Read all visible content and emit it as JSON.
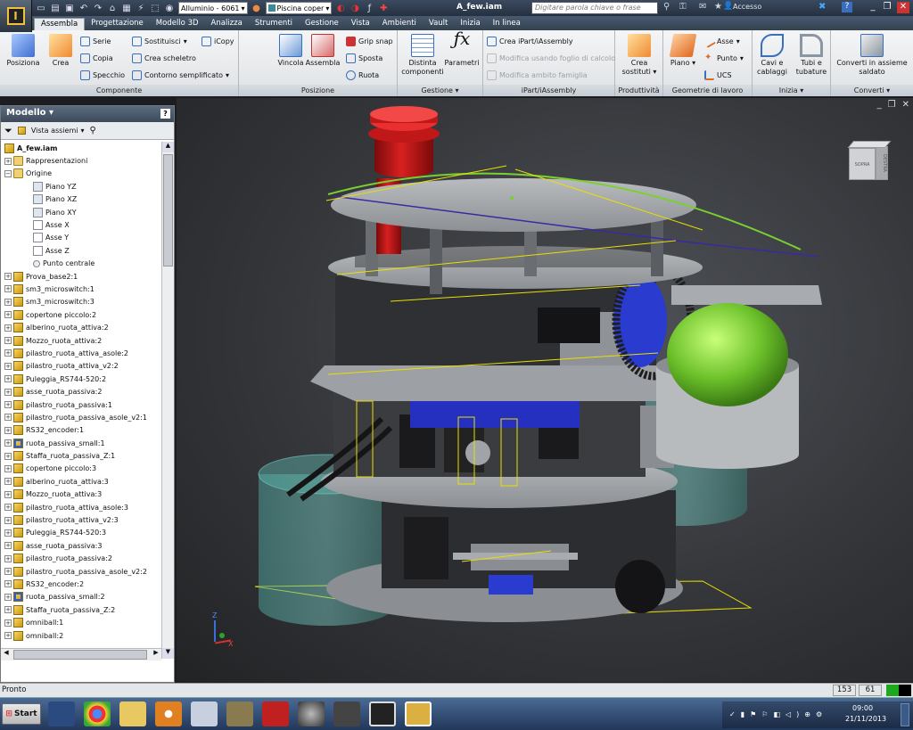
{
  "titlebar": {
    "app_badge": "PRO",
    "material": "Alluminio - 6061",
    "appearance": "Piscina coper",
    "doc_title": "A_few.iam",
    "search_placeholder": "Digitare parola chiave o frase",
    "login": "Accesso",
    "help": "?"
  },
  "tabs": [
    "Assembla",
    "Progettazione",
    "Modello 3D",
    "Analizza",
    "Strumenti",
    "Gestione",
    "Vista",
    "Ambienti",
    "Vault",
    "Inizia",
    "In linea"
  ],
  "ribbon": {
    "componente": {
      "label": "Componente",
      "posiziona": "Posiziona",
      "crea": "Crea",
      "serie": "Serie",
      "copia": "Copia",
      "specchio": "Specchio",
      "sostituisci": "Sostituisci",
      "crea_scheletro": "Crea scheletro",
      "contorno": "Contorno semplificato",
      "icopy": "iCopy"
    },
    "posizione": {
      "label": "Posizione",
      "vincola": "Vincola",
      "assembla": "Assembla",
      "grip_snap": "Grip snap",
      "sposta": "Sposta",
      "ruota": "Ruota"
    },
    "gestione": {
      "label": "Gestione",
      "distinta": "Distinta componenti",
      "parametri": "Parametri"
    },
    "ipart": {
      "label": "iPart/iAssembly",
      "crea": "Crea iPart/iAssembly",
      "modifica_foglio": "Modifica usando foglio di calcolo",
      "modifica_ambito": "Modifica ambito famiglia"
    },
    "produttivita": {
      "label": "Produttività",
      "crea_sostituti": "Crea sostituti"
    },
    "geometrie": {
      "label": "Geometrie di lavoro",
      "piano": "Piano",
      "asse": "Asse",
      "punto": "Punto",
      "ucs": "UCS"
    },
    "inizia": {
      "label": "Inizia",
      "cavi": "Cavi e cablaggi",
      "tubi": "Tubi e tubature"
    },
    "converti": {
      "label": "Converti",
      "converti_saldato": "Converti in assieme saldato"
    }
  },
  "browser": {
    "title": "Modello",
    "view_mode": "Vista assiemi",
    "root": "A_few.iam",
    "nodes": [
      {
        "label": "Rappresentazioni",
        "type": "folder",
        "level": 1,
        "exp": "+"
      },
      {
        "label": "Origine",
        "type": "folder",
        "level": 1,
        "exp": "−"
      },
      {
        "label": "Piano YZ",
        "type": "plane",
        "level": 2,
        "exp": ""
      },
      {
        "label": "Piano XZ",
        "type": "plane",
        "level": 2,
        "exp": ""
      },
      {
        "label": "Piano XY",
        "type": "plane",
        "level": 2,
        "exp": ""
      },
      {
        "label": "Asse X",
        "type": "axis",
        "level": 2,
        "exp": ""
      },
      {
        "label": "Asse Y",
        "type": "axis",
        "level": 2,
        "exp": ""
      },
      {
        "label": "Asse Z",
        "type": "axis",
        "level": 2,
        "exp": ""
      },
      {
        "label": "Punto centrale",
        "type": "pt",
        "level": 2,
        "exp": ""
      },
      {
        "label": "Prova_base2:1",
        "type": "part",
        "level": 1,
        "exp": "+"
      },
      {
        "label": "sm3_microswitch:1",
        "type": "part",
        "level": 1,
        "exp": "+"
      },
      {
        "label": "sm3_microswitch:3",
        "type": "part",
        "level": 1,
        "exp": "+"
      },
      {
        "label": "copertone piccolo:2",
        "type": "part",
        "level": 1,
        "exp": "+"
      },
      {
        "label": "alberino_ruota_attiva:2",
        "type": "part",
        "level": 1,
        "exp": "+"
      },
      {
        "label": "Mozzo_ruota_attiva:2",
        "type": "part",
        "level": 1,
        "exp": "+"
      },
      {
        "label": "pilastro_ruota_attiva_asole:2",
        "type": "part",
        "level": 1,
        "exp": "+"
      },
      {
        "label": "pilastro_ruota_attiva_v2:2",
        "type": "part",
        "level": 1,
        "exp": "+"
      },
      {
        "label": "Puleggia_RS744-520:2",
        "type": "part",
        "level": 1,
        "exp": "+"
      },
      {
        "label": "asse_ruota_passiva:2",
        "type": "part",
        "level": 1,
        "exp": "+"
      },
      {
        "label": "pilastro_ruota_passiva:1",
        "type": "part",
        "level": 1,
        "exp": "+"
      },
      {
        "label": "pilastro_ruota_passiva_asole_v2:1",
        "type": "part",
        "level": 1,
        "exp": "+"
      },
      {
        "label": "RS32_encoder:1",
        "type": "part",
        "level": 1,
        "exp": "+"
      },
      {
        "label": "ruota_passiva_small:1",
        "type": "asm",
        "level": 1,
        "exp": "+"
      },
      {
        "label": "Staffa_ruota_passiva_Z:1",
        "type": "part",
        "level": 1,
        "exp": "+"
      },
      {
        "label": "copertone piccolo:3",
        "type": "part",
        "level": 1,
        "exp": "+"
      },
      {
        "label": "alberino_ruota_attiva:3",
        "type": "part",
        "level": 1,
        "exp": "+"
      },
      {
        "label": "Mozzo_ruota_attiva:3",
        "type": "part",
        "level": 1,
        "exp": "+"
      },
      {
        "label": "pilastro_ruota_attiva_asole:3",
        "type": "part",
        "level": 1,
        "exp": "+"
      },
      {
        "label": "pilastro_ruota_attiva_v2:3",
        "type": "part",
        "level": 1,
        "exp": "+"
      },
      {
        "label": "Puleggia_RS744-520:3",
        "type": "part",
        "level": 1,
        "exp": "+"
      },
      {
        "label": "asse_ruota_passiva:3",
        "type": "part",
        "level": 1,
        "exp": "+"
      },
      {
        "label": "pilastro_ruota_passiva:2",
        "type": "part",
        "level": 1,
        "exp": "+"
      },
      {
        "label": "pilastro_ruota_passiva_asole_v2:2",
        "type": "part",
        "level": 1,
        "exp": "+"
      },
      {
        "label": "RS32_encoder:2",
        "type": "part",
        "level": 1,
        "exp": "+"
      },
      {
        "label": "ruota_passiva_small:2",
        "type": "asm",
        "level": 1,
        "exp": "+"
      },
      {
        "label": "Staffa_ruota_passiva_Z:2",
        "type": "part",
        "level": 1,
        "exp": "+"
      },
      {
        "label": "omniball:1",
        "type": "part",
        "level": 1,
        "exp": "+"
      },
      {
        "label": "omniball:2",
        "type": "part",
        "level": 1,
        "exp": "+"
      }
    ]
  },
  "viewcube": {
    "face_front": "DESTRA",
    "face_top": "SOPRA"
  },
  "axis_labels": {
    "x": "X",
    "z": "Z"
  },
  "status": {
    "text": "Pronto",
    "count1": "153",
    "count2": "61"
  },
  "taskbar": {
    "start": "Start",
    "time": "09:00",
    "date": "21/11/2013"
  },
  "colors": {
    "accent": "#2f7ed8",
    "highlight_edge": "#e8e000",
    "active_green": "#1ea81e"
  }
}
